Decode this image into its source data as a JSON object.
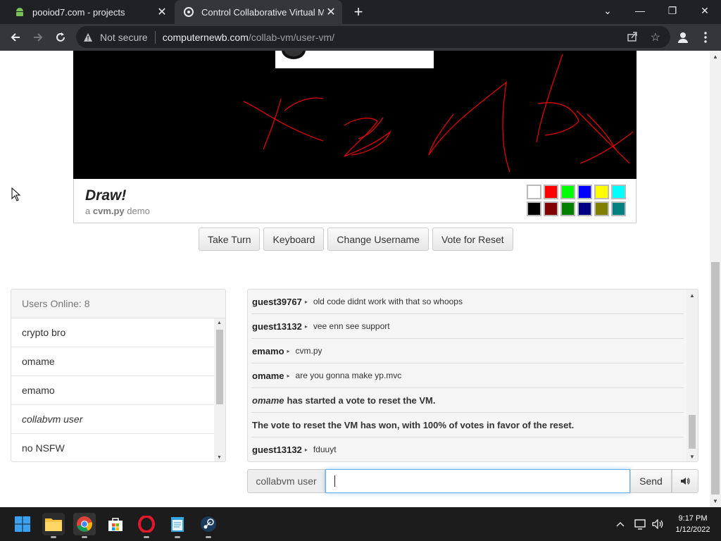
{
  "browser": {
    "tabs": [
      {
        "title": "pooiod7.com - projects"
      },
      {
        "title": "Control Collaborative Virtual Mac"
      }
    ],
    "address": {
      "security": "Not secure",
      "host": "computernewb.com",
      "path": "/collab-vm/user-vm/"
    }
  },
  "draw": {
    "title": "Draw!",
    "sub_prefix": "a",
    "sub_bold": "cvm.py",
    "sub_suffix": "demo",
    "palette": [
      "#ffffff",
      "#ff0000",
      "#00ff00",
      "#0000ff",
      "#ffff00",
      "#00ffff",
      "#000000",
      "#800000",
      "#008000",
      "#000080",
      "#808000",
      "#008080"
    ]
  },
  "buttons": {
    "take_turn": "Take Turn",
    "keyboard": "Keyboard",
    "change_username": "Change Username",
    "vote_reset": "Vote for Reset"
  },
  "users": {
    "header": "Users Online: 8",
    "list": [
      {
        "name": "crypto bro",
        "italic": false
      },
      {
        "name": "omame",
        "italic": false
      },
      {
        "name": "emamo",
        "italic": false
      },
      {
        "name": "collabvm user",
        "italic": true
      },
      {
        "name": "no NSFW",
        "italic": false
      }
    ]
  },
  "chat": {
    "messages": [
      {
        "user": "guest39767",
        "text": "old code didnt work with that so whoops"
      },
      {
        "user": "guest13132",
        "text": "vee enn see support"
      },
      {
        "user": "emamo",
        "text": "cvm.py"
      },
      {
        "user": "omame",
        "text": "are you gonna make yp.mvc"
      },
      {
        "system_user": "omame",
        "system_text": "has started a vote to reset the VM."
      },
      {
        "system_text": "The vote to reset the VM has won, with 100% of votes in favor of the reset."
      },
      {
        "user": "guest13132",
        "text": "fduuyt"
      }
    ],
    "username_label": "collabvm user",
    "input_value": "",
    "send_label": "Send"
  },
  "taskbar": {
    "time": "9:17 PM",
    "date": "1/12/2022"
  }
}
